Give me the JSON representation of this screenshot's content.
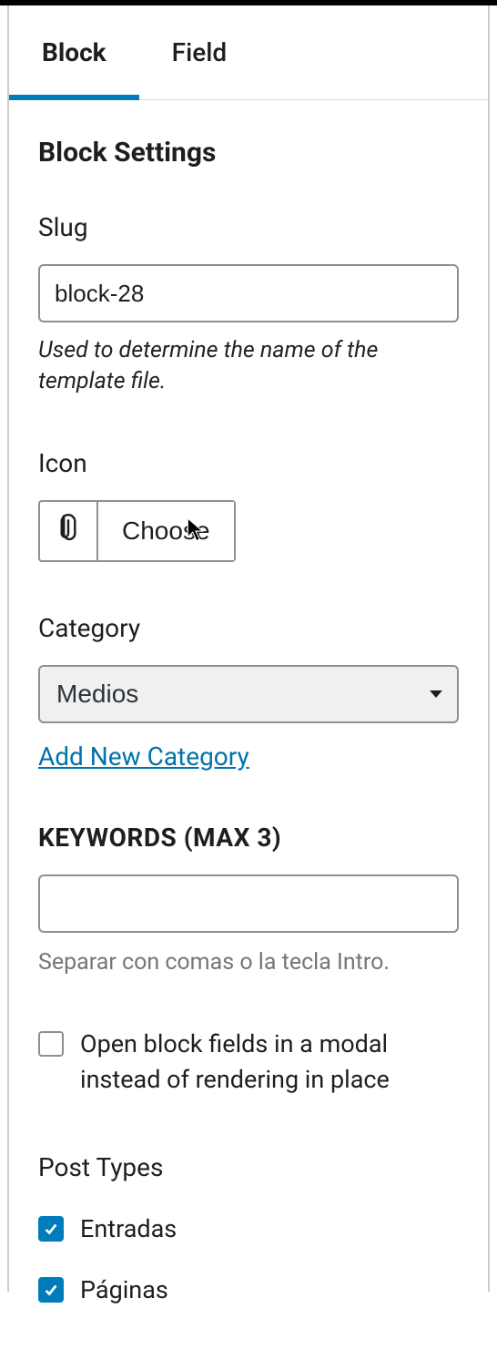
{
  "tabs": {
    "block": "Block",
    "field": "Field"
  },
  "section_title": "Block Settings",
  "slug": {
    "label": "Slug",
    "value": "block-28",
    "help": "Used to determine the name of the template file."
  },
  "icon": {
    "label": "Icon",
    "choose_label": "Choose"
  },
  "category": {
    "label": "Category",
    "selected": "Medios",
    "add_new": "Add New Category"
  },
  "keywords": {
    "label": "KEYWORDS (MAX 3)",
    "value": "",
    "help": "Separar con comas o la tecla Intro."
  },
  "modal_checkbox": {
    "label": "Open block fields in a modal instead of rendering in place",
    "checked": false
  },
  "post_types": {
    "label": "Post Types",
    "items": [
      {
        "label": "Entradas",
        "checked": true
      },
      {
        "label": "Páginas",
        "checked": true
      }
    ]
  }
}
